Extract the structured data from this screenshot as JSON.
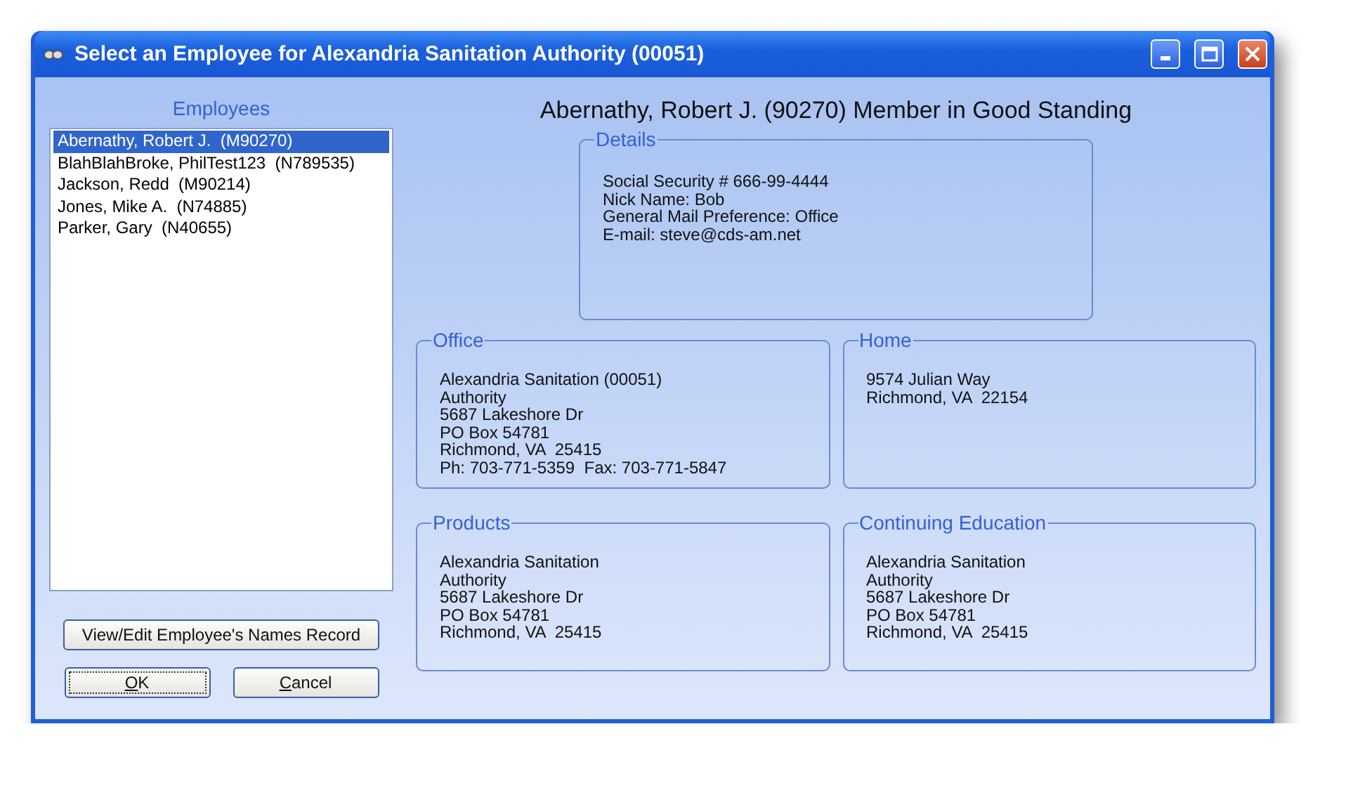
{
  "window": {
    "title": "Select an Employee for Alexandria Sanitation Authority (00051)"
  },
  "employees": {
    "label": "Employees",
    "items": [
      {
        "text": "Abernathy, Robert J.  (M90270)",
        "selected": true
      },
      {
        "text": "BlahBlahBroke, PhilTest123  (N789535)",
        "selected": false
      },
      {
        "text": "Jackson, Redd  (M90214)",
        "selected": false
      },
      {
        "text": "Jones, Mike A.  (N74885)",
        "selected": false
      },
      {
        "text": "Parker, Gary  (N40655)",
        "selected": false
      }
    ]
  },
  "buttons": {
    "view_edit": "View/Edit Employee's Names Record",
    "ok": "OK",
    "cancel": "Cancel"
  },
  "header": "Abernathy, Robert J. (90270) Member in Good Standing",
  "details": {
    "title": "Details",
    "lines": [
      "Social Security # 666-99-4444",
      "Nick Name: Bob",
      "General Mail Preference: Office",
      "E-mail: steve@cds-am.net"
    ]
  },
  "groups": [
    {
      "title": "Office",
      "lines": [
        "Alexandria Sanitation (00051)",
        "Authority",
        "5687 Lakeshore Dr",
        "PO Box 54781",
        "Richmond, VA  25415",
        "Ph: 703-771-5359  Fax: 703-771-5847"
      ]
    },
    {
      "title": "Home",
      "lines": [
        "9574 Julian Way",
        "Richmond, VA  22154"
      ]
    },
    {
      "title": "Products",
      "lines": [
        "Alexandria Sanitation",
        "Authority",
        "5687 Lakeshore Dr",
        "PO Box 54781",
        "Richmond, VA  25415"
      ]
    },
    {
      "title": "Continuing Education",
      "lines": [
        "Alexandria Sanitation",
        "Authority",
        "5687 Lakeshore Dr",
        "PO Box 54781",
        "Richmond, VA  25415"
      ]
    }
  ]
}
